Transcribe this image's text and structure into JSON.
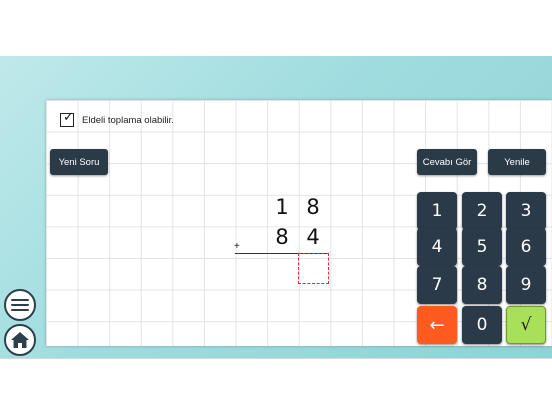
{
  "settings": {
    "carry_label": "Eldeli toplama olabilir.",
    "carry_checked": true
  },
  "buttons": {
    "new_question": "Yeni Soru",
    "show_answer": "Cevabı Gör",
    "refresh": "Yenile"
  },
  "problem": {
    "top": [
      "1",
      "8"
    ],
    "bottom": [
      "8",
      "4"
    ],
    "operator": "+",
    "answer": ""
  },
  "keypad": {
    "keys": [
      "1",
      "2",
      "3",
      "4",
      "5",
      "6",
      "7",
      "8",
      "9",
      "←",
      "0",
      "√"
    ]
  },
  "colors": {
    "background": "#9fdcdf",
    "key_dark": "#2a3a48",
    "key_back": "#ff5a1f",
    "key_ok": "#a9e05a",
    "answer_box_border": "#e02c2c"
  },
  "icons": {
    "menu": "menu-icon",
    "home": "home-icon"
  }
}
